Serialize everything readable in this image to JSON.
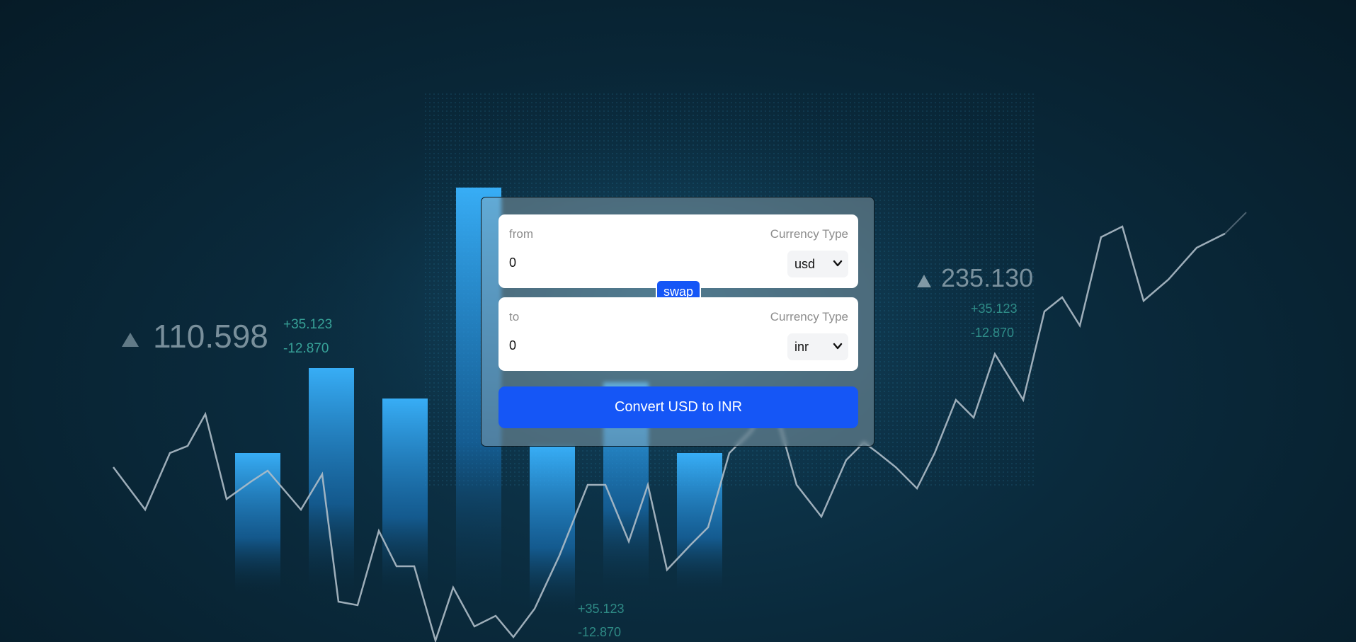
{
  "background": {
    "tickers": [
      {
        "value": "110.598",
        "up": "+35.123",
        "down": "-12.870"
      },
      {
        "value": "235.130",
        "up": "+35.123",
        "down": "-12.870"
      },
      {
        "up": "+35.123",
        "down": "-12.870"
      }
    ]
  },
  "converter": {
    "from": {
      "label": "from",
      "type_label": "Currency Type",
      "amount": "0",
      "currency": "usd"
    },
    "to": {
      "label": "to",
      "type_label": "Currency Type",
      "amount": "0",
      "currency": "inr"
    },
    "swap_label": "swap",
    "convert_label": "Convert USD to INR"
  },
  "colors": {
    "accent": "#1556f6",
    "background": "#0a2a3c"
  }
}
